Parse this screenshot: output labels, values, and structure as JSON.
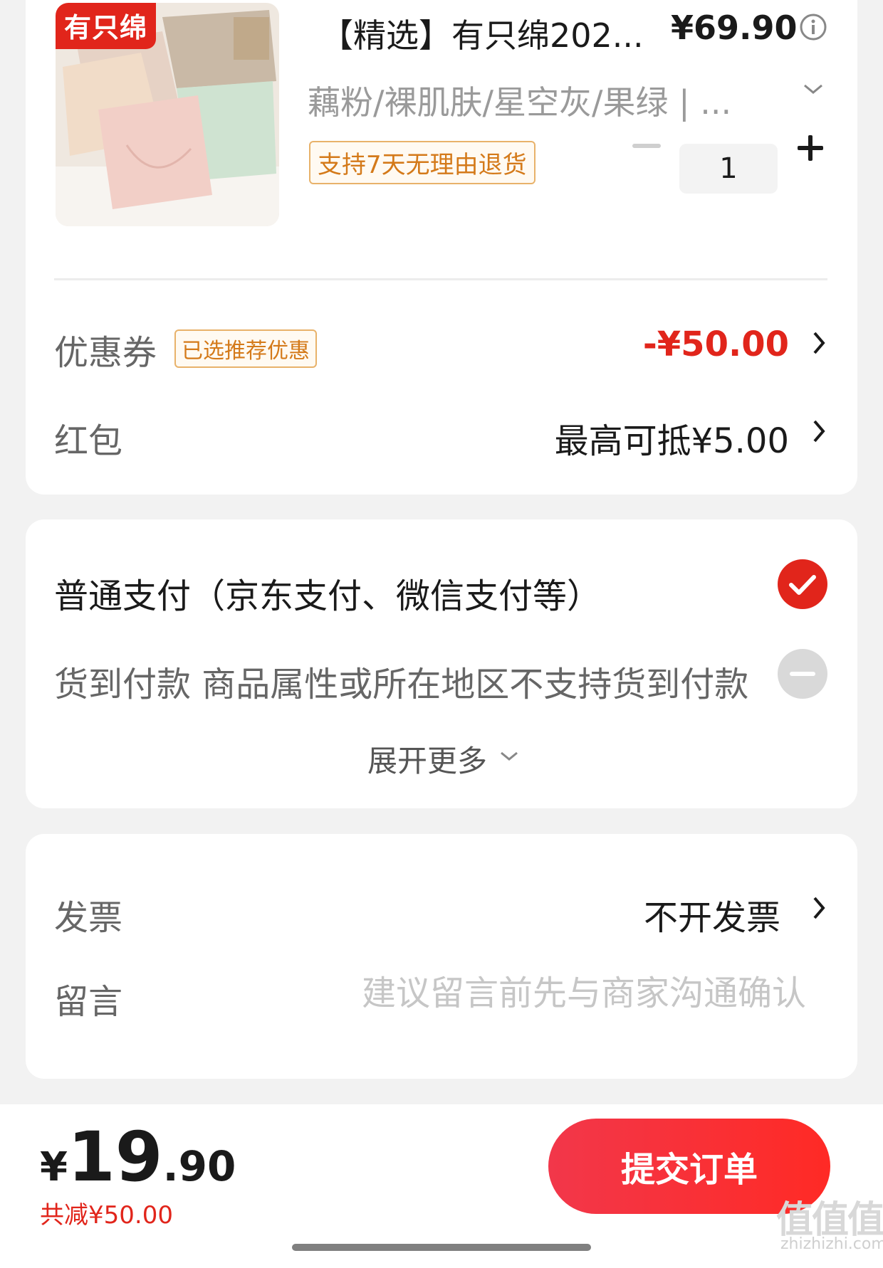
{
  "product": {
    "brand_tag": "有只绵",
    "title": "【精选】有只绵202...",
    "price": "¥69.90",
    "spec": "藕粉/裸肌肤/星空灰/果绿 | ...",
    "return_policy": "支持7天无理由退货",
    "quantity": "1"
  },
  "coupon": {
    "label": "优惠券",
    "badge": "已选推荐优惠",
    "value": "-¥50.00"
  },
  "red_packet": {
    "label": "红包",
    "value": "最高可抵¥5.00"
  },
  "payment": {
    "option_normal": "普通支付（京东支付、微信支付等）",
    "option_cod": "货到付款 商品属性或所在地区不支持货到付款",
    "expand_more": "展开更多"
  },
  "invoice": {
    "label": "发票",
    "value": "不开发票"
  },
  "message": {
    "label": "留言",
    "placeholder": "建议留言前先与商家沟通确认"
  },
  "footer": {
    "currency": "¥",
    "total_int": "19",
    "total_dec": ".90",
    "discount": "共减¥50.00",
    "submit": "提交订单"
  },
  "watermark": {
    "main": "值值值",
    "sub": "zhizhizhi.com"
  },
  "colors": {
    "accent": "#e1251b",
    "badge_border": "#e8b26a",
    "badge_text": "#d47a1a"
  }
}
